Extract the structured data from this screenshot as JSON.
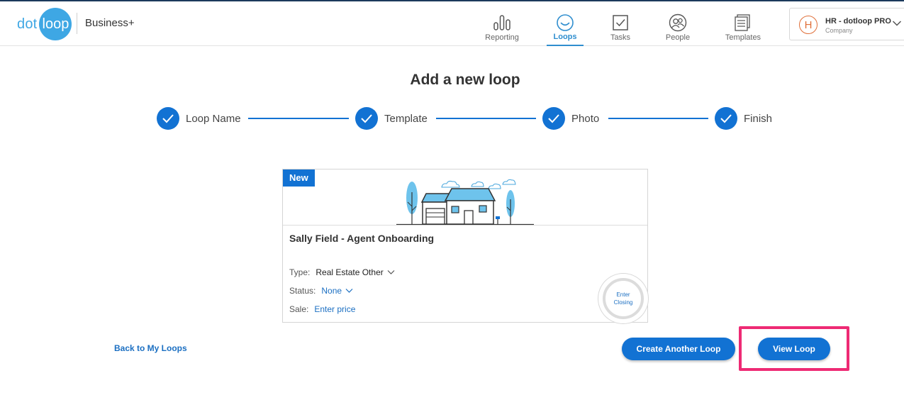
{
  "header": {
    "logo": {
      "left": "dot",
      "right": "loop"
    },
    "brand": "Business+",
    "nav": [
      {
        "label": "Reporting",
        "icon": "bar-chart-icon",
        "active": false
      },
      {
        "label": "Loops",
        "icon": "loop-icon",
        "active": true
      },
      {
        "label": "Tasks",
        "icon": "checkbox-icon",
        "active": false
      },
      {
        "label": "People",
        "icon": "people-icon",
        "active": false
      },
      {
        "label": "Templates",
        "icon": "templates-icon",
        "active": false
      }
    ],
    "account": {
      "initial": "H",
      "name": "HR - dotloop PRO",
      "subtitle": "Company"
    }
  },
  "page": {
    "title": "Add a new loop",
    "steps": [
      {
        "label": "Loop Name",
        "completed": true
      },
      {
        "label": "Template",
        "completed": true
      },
      {
        "label": "Photo",
        "completed": true
      },
      {
        "label": "Finish",
        "completed": true
      }
    ]
  },
  "card": {
    "badge": "New",
    "title": "Sally Field - Agent Onboarding",
    "type_label": "Type:",
    "type_value": "Real Estate Other",
    "status_label": "Status:",
    "status_value": "None",
    "sale_label": "Sale:",
    "sale_value": "Enter price",
    "closing_line1": "Enter",
    "closing_line2": "Closing"
  },
  "actions": {
    "back": "Back to My Loops",
    "create_another": "Create Another Loop",
    "view_loop": "View Loop"
  },
  "colors": {
    "primary": "#1272d3",
    "logo_blue": "#3ea7e4",
    "highlight": "#ee2a74",
    "avatar": "#e0703a"
  }
}
